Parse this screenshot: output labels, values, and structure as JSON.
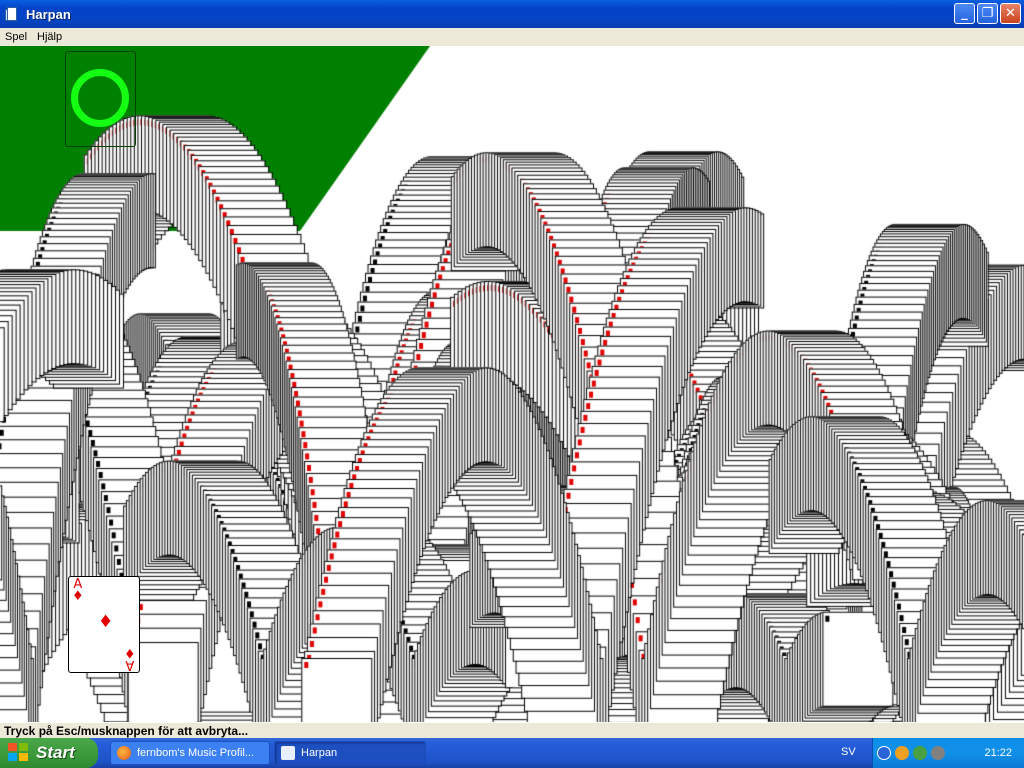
{
  "window": {
    "title": "Harpan",
    "controls": {
      "minimize": "_",
      "maximize": "❐",
      "close": "✕"
    }
  },
  "menu": {
    "items": [
      "Spel",
      "Hjälp"
    ]
  },
  "game": {
    "name": "Harpan",
    "state": "win-animation",
    "felt_color": "#008000",
    "foundation_ring_color": "#14ff14",
    "visible_card": {
      "rank": "A",
      "suit": "♦",
      "color": "#e00000"
    },
    "status_text": "Tryck på Esc/musknappen för att avbryta..."
  },
  "taskbar": {
    "start_label": "Start",
    "tasks": [
      {
        "label": "fernbom's Music Profil...",
        "icon": "firefox-icon",
        "active": false
      },
      {
        "label": "Harpan",
        "icon": "solitaire-icon",
        "active": true
      }
    ],
    "language": "SV",
    "clock": "21:22",
    "tray_icons": [
      "back-arrow-icon",
      "network-icon",
      "messenger-icon",
      "volume-icon"
    ]
  }
}
